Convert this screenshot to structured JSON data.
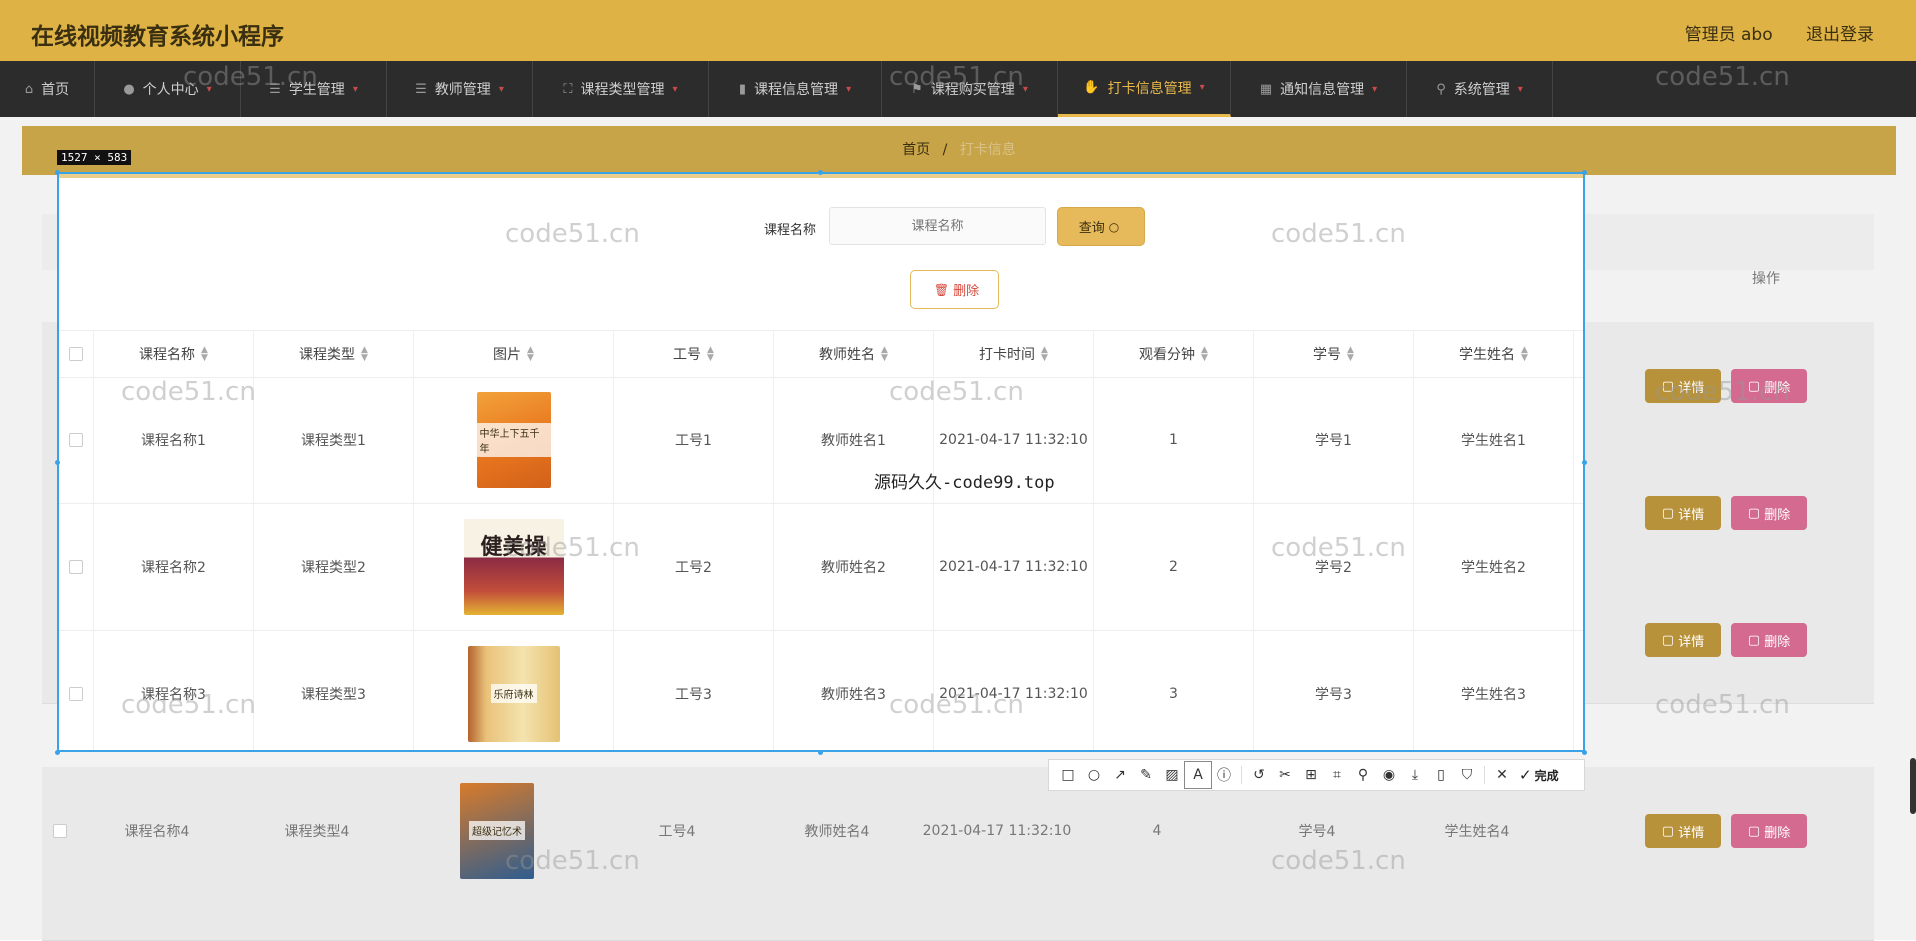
{
  "header": {
    "title": "在线视频教育系统小程序",
    "user_label": "管理员 abo",
    "logout_label": "退出登录"
  },
  "nav": {
    "items": [
      {
        "label": "首页",
        "icon": "home-icon"
      },
      {
        "label": "个人中心",
        "icon": "user-icon"
      },
      {
        "label": "学生管理",
        "icon": "list-icon"
      },
      {
        "label": "教师管理",
        "icon": "list-icon"
      },
      {
        "label": "课程类型管理",
        "icon": "expand-icon"
      },
      {
        "label": "课程信息管理",
        "icon": "bar-chart-icon"
      },
      {
        "label": "课程购买管理",
        "icon": "flag-icon"
      },
      {
        "label": "打卡信息管理",
        "icon": "thumb-icon"
      },
      {
        "label": "通知信息管理",
        "icon": "grid-icon"
      },
      {
        "label": "系统管理",
        "icon": "search-icon"
      }
    ],
    "active_index": 7
  },
  "breadcrumb": {
    "home": "首页",
    "separator": "/",
    "current": "打卡信息"
  },
  "capture": {
    "size_label": "1527 × 583"
  },
  "search": {
    "label": "课程名称",
    "placeholder": "课程名称",
    "button_label": "查询"
  },
  "toolbar": {
    "delete_label": "删除",
    "done_label": "完成"
  },
  "table": {
    "headers": [
      "课程名称",
      "课程类型",
      "图片",
      "工号",
      "教师姓名",
      "打卡时间",
      "观看分钟",
      "学号",
      "学生姓名"
    ],
    "action_header": "操作",
    "detail_label": "详情",
    "delete_label": "删除",
    "rows": [
      {
        "course": "课程名称1",
        "type": "课程类型1",
        "book_title": "中华上下五千年",
        "teacher_id": "工号1",
        "teacher": "教师姓名1",
        "time": "2021-04-17 11:32:10",
        "minutes": "1",
        "student_id": "学号1",
        "student": "学生姓名1"
      },
      {
        "course": "课程名称2",
        "type": "课程类型2",
        "book_title": "健美操",
        "teacher_id": "工号2",
        "teacher": "教师姓名2",
        "time": "2021-04-17 11:32:10",
        "minutes": "2",
        "student_id": "学号2",
        "student": "学生姓名2"
      },
      {
        "course": "课程名称3",
        "type": "课程类型3",
        "book_title": "乐府诗林",
        "teacher_id": "工号3",
        "teacher": "教师姓名3",
        "time": "2021-04-17 11:32:10",
        "minutes": "3",
        "student_id": "学号3",
        "student": "学生姓名3"
      },
      {
        "course": "课程名称4",
        "type": "课程类型4",
        "book_title": "超级记忆术",
        "teacher_id": "工号4",
        "teacher": "教师姓名4",
        "time": "2021-04-17 11:32:10",
        "minutes": "4",
        "student_id": "学号4",
        "student": "学生姓名4"
      }
    ]
  },
  "overlay_text": "源码久久-code99.top",
  "watermark": "code51.cn",
  "colors": {
    "brand": "#deb244",
    "nav_bg": "#2c2c2c",
    "nav_active": "#e8b84a",
    "capture_border": "#3aa3e8",
    "danger": "#d6463a"
  }
}
